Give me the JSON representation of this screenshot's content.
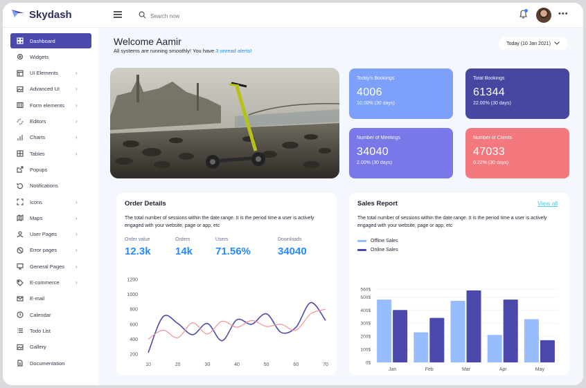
{
  "brand": {
    "name": "Skydash"
  },
  "topbar": {
    "search_placeholder": "Search now"
  },
  "sidebar": {
    "items": [
      {
        "label": "Dashboard",
        "icon": "dashboard-icon",
        "active": true,
        "chevron": false
      },
      {
        "label": "Widgets",
        "icon": "widgets-icon",
        "chevron": false
      },
      {
        "label": "UI Elements",
        "icon": "layout-icon",
        "chevron": true
      },
      {
        "label": "Advanced UI",
        "icon": "image-icon",
        "chevron": true
      },
      {
        "label": "Form elements",
        "icon": "columns-icon",
        "chevron": true
      },
      {
        "label": "Editors",
        "icon": "loader-icon",
        "chevron": true
      },
      {
        "label": "Charts",
        "icon": "bar-chart-icon",
        "chevron": true
      },
      {
        "label": "Tables",
        "icon": "grid-icon",
        "chevron": true
      },
      {
        "label": "Popups",
        "icon": "external-link-icon",
        "chevron": false
      },
      {
        "label": "Notifications",
        "icon": "refresh-icon",
        "chevron": false
      },
      {
        "label": "Icons",
        "icon": "maximize-icon",
        "chevron": true
      },
      {
        "label": "Maps",
        "icon": "map-icon",
        "chevron": true
      },
      {
        "label": "User Pages",
        "icon": "user-icon",
        "chevron": true
      },
      {
        "label": "Error pages",
        "icon": "slash-icon",
        "chevron": true
      },
      {
        "label": "General Pages",
        "icon": "monitor-icon",
        "chevron": true
      },
      {
        "label": "E-commerce",
        "icon": "tag-icon",
        "chevron": true
      },
      {
        "label": "E-mail",
        "icon": "mail-icon",
        "chevron": false
      },
      {
        "label": "Calendar",
        "icon": "clock-icon",
        "chevron": false
      },
      {
        "label": "Todo List",
        "icon": "list-icon",
        "chevron": false
      },
      {
        "label": "Gallery",
        "icon": "image-icon",
        "chevron": false
      },
      {
        "label": "Documentation",
        "icon": "file-icon",
        "chevron": false
      }
    ]
  },
  "header": {
    "welcome": "Welcome Aamir",
    "subtitle_prefix": "All systems are running smoothly! You have ",
    "subtitle_link": "3 unread alerts!",
    "date_button": "Today (10 Jan 2021)"
  },
  "stats": [
    {
      "label": "Today's Bookings",
      "value": "4006",
      "sub": "10.00% (30 days)",
      "color": "#7da0fa"
    },
    {
      "label": "Total Bookings",
      "value": "61344",
      "sub": "22.00% (30 days)",
      "color": "#4747a1"
    },
    {
      "label": "Number of Meetings",
      "value": "34040",
      "sub": "2.00% (30 days)",
      "color": "#7978e9"
    },
    {
      "label": "Number of Clients",
      "value": "47033",
      "sub": "0.22% (30 days)",
      "color": "#f3797e"
    }
  ],
  "order_details": {
    "title": "Order Details",
    "description": "The total number of sessions within the date range. It is the period time a user is actively engaged with your website, page or app, etc",
    "metrics": [
      {
        "label": "Order value",
        "value": "12.3k"
      },
      {
        "label": "Orders",
        "value": "14k"
      },
      {
        "label": "Users",
        "value": "71.56%"
      },
      {
        "label": "Downloads",
        "value": "34040"
      }
    ]
  },
  "sales_report": {
    "title": "Sales Report",
    "view_all": "View all",
    "description": "The total number of sessions within the date range. It is the period time a user is actively engaged with your website, page or app, etc"
  },
  "chart_data": [
    {
      "type": "line",
      "x": [
        10,
        15,
        20,
        25,
        30,
        35,
        40,
        45,
        50,
        55,
        60,
        65,
        70
      ],
      "xticks": [
        "10",
        "20",
        "30",
        "40",
        "50",
        "60",
        "70"
      ],
      "yticks": [
        "200",
        "400",
        "600",
        "800",
        "1000",
        "1200"
      ],
      "ylim": [
        200,
        1200
      ],
      "xlim": [
        10,
        70
      ],
      "series": [
        {
          "color": "#4b49ac",
          "values": [
            220,
            700,
            610,
            460,
            610,
            380,
            660,
            600,
            740,
            490,
            560,
            890,
            650
          ]
        },
        {
          "color": "#f09397",
          "values": [
            400,
            520,
            420,
            620,
            470,
            640,
            560,
            650,
            570,
            600,
            520,
            740,
            800
          ]
        }
      ]
    },
    {
      "type": "bar",
      "categories": [
        "Jan",
        "Feb",
        "Mar",
        "Apr",
        "May"
      ],
      "yticks": [
        "0$",
        "100$",
        "200$",
        "300$",
        "400$",
        "500$",
        "560$"
      ],
      "ylim": [
        0,
        560
      ],
      "series": [
        {
          "name": "Offline Sales",
          "color": "#98bdff",
          "values": [
            480,
            230,
            470,
            210,
            330
          ]
        },
        {
          "name": "Online Sales",
          "color": "#4b49ac",
          "values": [
            400,
            340,
            550,
            480,
            170
          ]
        }
      ]
    }
  ]
}
